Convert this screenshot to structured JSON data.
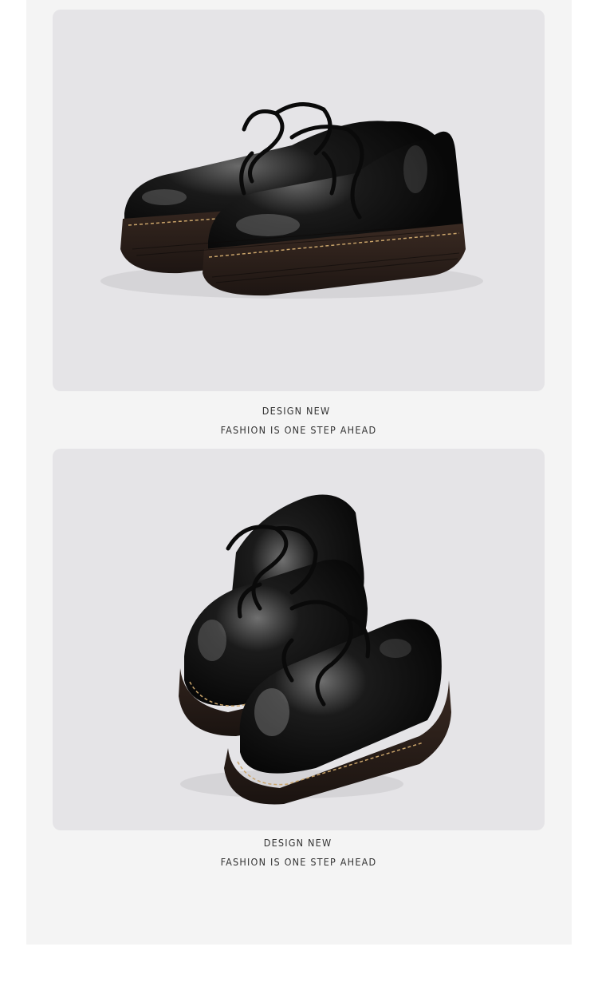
{
  "sections": [
    {
      "image_icon": "black-leather-derby-shoes-side-view",
      "caption_line1": "DESIGN NEW",
      "caption_line2": "FASHION IS ONE STEP AHEAD"
    },
    {
      "image_icon": "black-leather-derby-shoes-angled-view",
      "caption_line1": "DESIGN NEW",
      "caption_line2": "FASHION IS ONE STEP AHEAD"
    }
  ],
  "colors": {
    "page_background": "#ffffff",
    "panel_background": "#f4f4f4",
    "photo_background": "#e5e4e7",
    "caption_text": "#333333",
    "shoe_leather": "#121212",
    "sole_stitch": "#c9a46a"
  }
}
